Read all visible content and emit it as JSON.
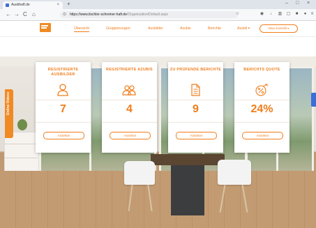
{
  "browser": {
    "tab_title": "Ausbhaft.de",
    "tab_close": "×",
    "new_tab": "+",
    "minimize": "–",
    "maximize": "□",
    "close": "×",
    "back": "←",
    "forward": "→",
    "reload": "C",
    "home": "⌂",
    "url_domain": "https://www.tischler-schreiner-haft.de",
    "url_path": "/Organisation/Default.aspx"
  },
  "nav": {
    "items": [
      {
        "label": "Übersicht",
        "active": true
      },
      {
        "label": "Gruppierungen",
        "active": false
      },
      {
        "label": "Ausbilder",
        "active": false
      },
      {
        "label": "Azubis",
        "active": false
      },
      {
        "label": "Berichte",
        "active": false
      },
      {
        "label": "Ausbil ▾",
        "active": false
      }
    ],
    "cta_label": "Neue Kontrolli ▾"
  },
  "cards": [
    {
      "title": "Registrierte Ausbilder",
      "icon": "user-icon",
      "value": "7",
      "button": "Ansehen"
    },
    {
      "title": "Registrierte Azubis",
      "icon": "users-icon",
      "value": "4",
      "button": "Ansehen"
    },
    {
      "title": "Zu prüfende Berichte",
      "icon": "document-icon",
      "value": "9",
      "button": "Ansehen"
    },
    {
      "title": "Berichts Quote",
      "icon": "percent-trend-icon",
      "value": "24%",
      "button": "Ansehen"
    }
  ],
  "side_tab": {
    "label": "Online Videos"
  },
  "colors": {
    "accent": "#f07d1a"
  }
}
